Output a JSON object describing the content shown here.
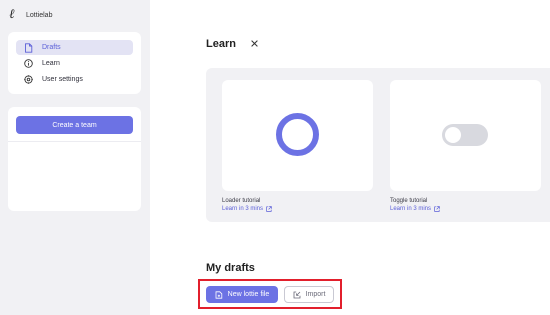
{
  "brand": {
    "logo": "ℓ",
    "name": "Lottielab"
  },
  "sidebar": {
    "items": [
      {
        "label": "Drafts",
        "icon": "file-icon",
        "active": true
      },
      {
        "label": "Learn",
        "icon": "info-icon",
        "active": false
      },
      {
        "label": "User settings",
        "icon": "settings-icon",
        "active": false
      }
    ],
    "create_team_label": "Create a team"
  },
  "learn": {
    "title": "Learn",
    "close_icon": "close-icon",
    "tutorials": [
      {
        "title": "Loader tutorial",
        "link": "Learn in 3 mins",
        "preview": "loader-ring"
      },
      {
        "title": "Toggle tutorial",
        "link": "Learn in 3 mins",
        "preview": "toggle-switch"
      }
    ]
  },
  "drafts": {
    "title": "My drafts",
    "new_button": "New lottie file",
    "import_button": "Import"
  },
  "colors": {
    "accent": "#6c72e4",
    "sidebar_bg": "#f1f1f4",
    "highlight": "#e21f2c",
    "toggle_track": "#d8d9df"
  }
}
